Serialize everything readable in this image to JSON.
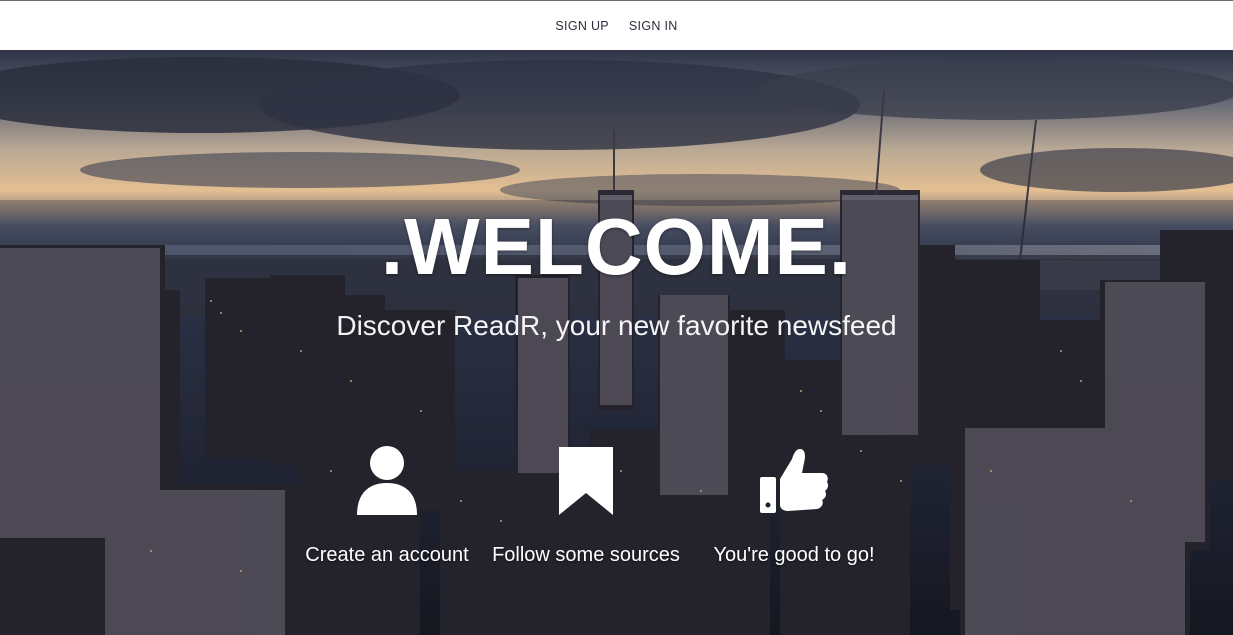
{
  "nav": {
    "signup_label": "SIGN UP",
    "signin_label": "SIGN IN"
  },
  "hero": {
    "title": ".WELCOME.",
    "subtitle": "Discover ReadR, your new favorite newsfeed"
  },
  "steps": [
    {
      "icon": "user-icon",
      "label": "Create an account"
    },
    {
      "icon": "bookmark-icon",
      "label": "Follow some sources"
    },
    {
      "icon": "thumbs-up-icon",
      "label": "You're good to go!"
    }
  ],
  "colors": {
    "navbar_bg": "#ffffff",
    "nav_text": "#2a2f3a",
    "hero_text": "#ffffff"
  }
}
